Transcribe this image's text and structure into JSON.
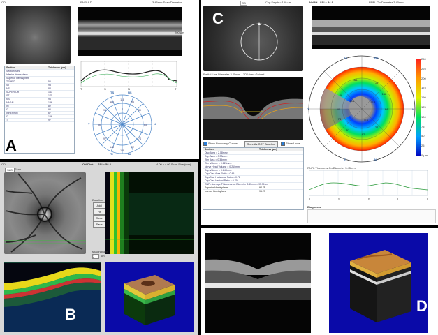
{
  "panelA": {
    "label": "A",
    "header_left": "OD",
    "header_mid": "RNFL/LD",
    "header_right": "3.45mm Scan Diameter",
    "scale": "200 µm",
    "table_header": [
      "Section",
      "Thickness (µm)"
    ],
    "rows": [
      [
        "Section Area",
        ""
      ],
      [
        "Inferior Hemisphere",
        ""
      ],
      [
        "Superior Hemisphere",
        ""
      ],
      [
        "TEMPO",
        "56"
      ],
      [
        "ST",
        "95"
      ],
      [
        "NS",
        "82"
      ],
      [
        "SUPERIOR",
        "143"
      ],
      [
        "ST",
        "171"
      ],
      [
        "NS",
        "96"
      ],
      [
        "NASAL",
        "136"
      ],
      [
        "IN",
        "82"
      ],
      [
        "IT",
        "96"
      ],
      [
        "INFERIOR",
        "67"
      ],
      [
        "IT",
        "156"
      ],
      [
        "TI",
        "97"
      ]
    ],
    "profile_ticks": [
      "T",
      "S",
      "N",
      "I",
      "T"
    ],
    "sector_labels": [
      "TS",
      "NS",
      "T",
      "N",
      "TI",
      "NI"
    ]
  },
  "panelB": {
    "label": "B",
    "header_left": "OD",
    "header_mid": "ON Disk",
    "header_ssi": "SSI = 58.4",
    "header_right": "4.00 x 4.00 Scan Size (mm)",
    "tab1": "SLO",
    "tab2": "Scan",
    "baseline_label": "Baseline",
    "buttons": [
      "Add",
      "Fit",
      "Clear",
      "Save"
    ],
    "spacing_label": "spacing(µm)",
    "spacing_value": "2",
    "um_label": "µm"
  },
  "panelC": {
    "label": "C",
    "header_left": "OD",
    "cup_depth": "Cup Depth = 150 um",
    "header_mid": "NHPH",
    "ssi": "SSI = 54.8",
    "rnfl_title": "RNFL On Diameter 3.40mm",
    "radial_label": "Radial Line Diameter 3.45mm",
    "video_label": "3D Video Guided",
    "chk_boundary": "Show Boundary Curves",
    "btn_baseline": "Save As OCT Baseline",
    "chk_lines": "Show Lines",
    "table_header": [
      "Section",
      "Thickness (µm)"
    ],
    "rows": [
      "Disc Area = 2.08mm²",
      "Cup Area = 0.33mm²",
      "Rim Area = 0.35mm²",
      "Rim Volume = 0.123mm³",
      "Nerve Head Volume = 0.210mm³",
      "Cup Volume = 0.243mm³",
      "Cup/Disc Area Ratio = 0.45",
      "Cup/Disc Horizontal Ratio = 0.78",
      "Cup/Disc Vertical Ratio = 0.79",
      "RNFL Average Thickness on Diameter 3.45mm = 95.31µm"
    ],
    "hemi_rows": [
      [
        "Superior Hemisphere",
        "94.75"
      ],
      [
        "Inferior Hemisphere",
        "96.27"
      ]
    ],
    "map_outer": [
      "TS",
      "NS",
      "T",
      "N",
      "TI",
      "NI"
    ],
    "map_inner": [
      "TS1",
      "S01",
      "NS1",
      "NS2",
      "ST1",
      "ST2",
      "NT1",
      "NT2",
      "N1",
      "N2",
      "T1",
      "T2",
      "IT1",
      "IT2",
      "IN1",
      "IN2",
      "TI2",
      "I01",
      "NI2"
    ],
    "map_values": [
      "153",
      "144",
      "152",
      "84",
      "127",
      "62",
      "57",
      "74",
      "60",
      "46",
      "115",
      "114",
      "114"
    ],
    "colorbar_ticks": [
      "250",
      "225",
      "200",
      "175",
      "150",
      "125",
      "100",
      "75",
      "50",
      "25",
      "0 µm"
    ],
    "profile_title": "RNFL Thickness On Diameter 3.45mm",
    "profile_ticks": [
      "T",
      "S",
      "N",
      "I",
      "T"
    ],
    "diagnosis": "Diagnosis"
  },
  "panelD": {
    "label": "D"
  }
}
